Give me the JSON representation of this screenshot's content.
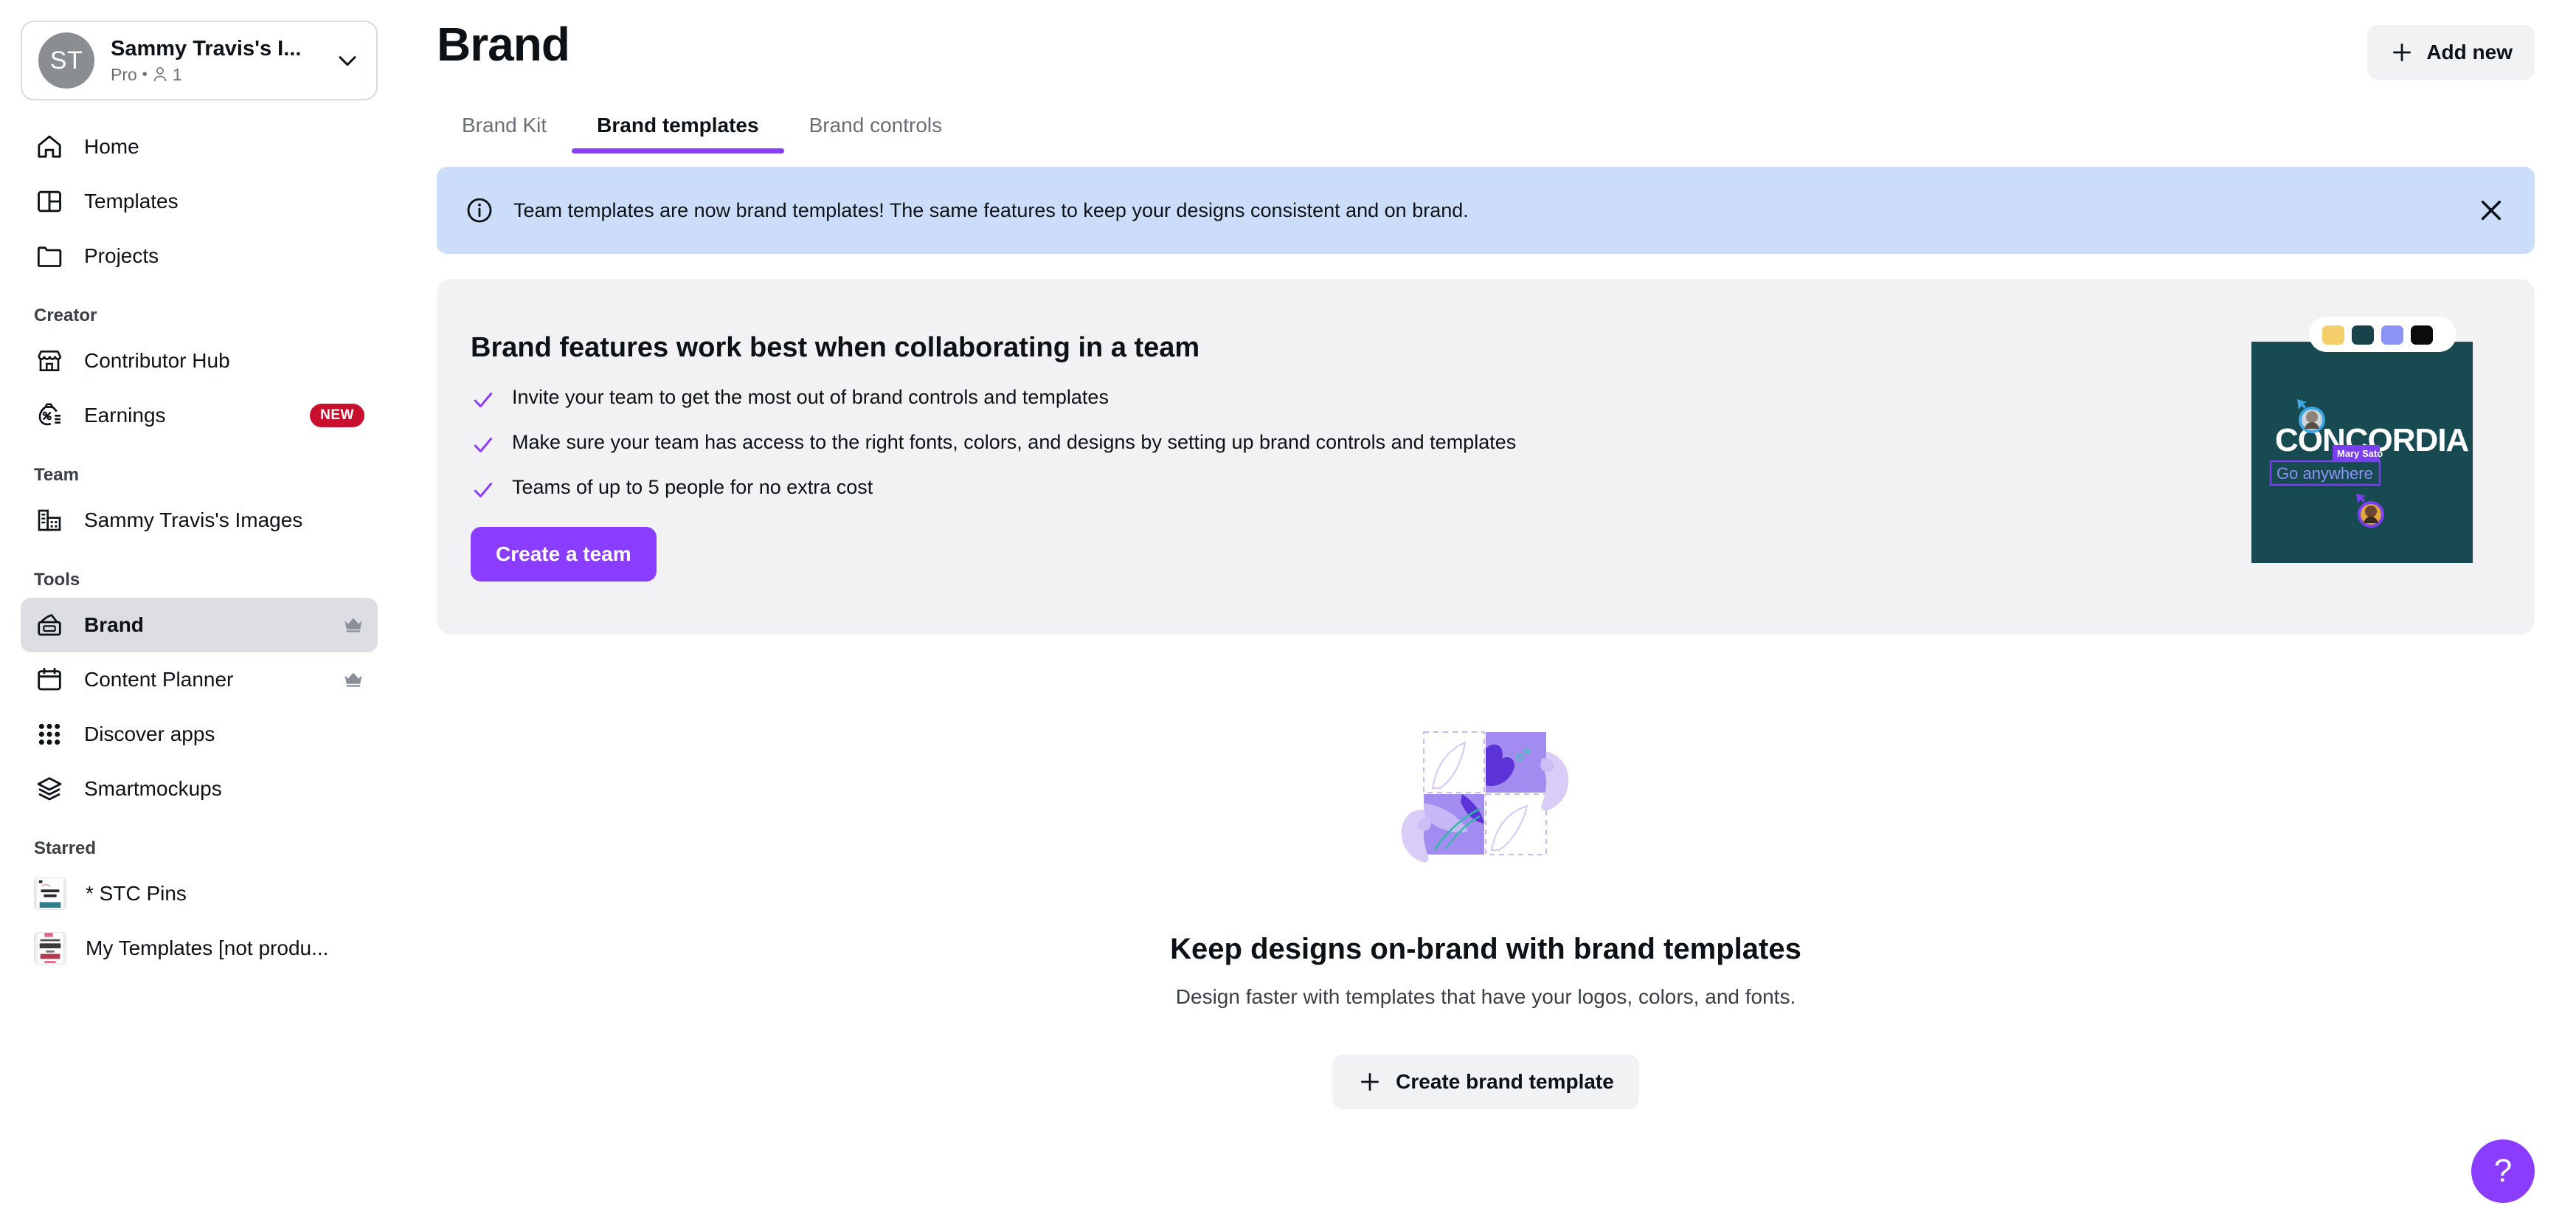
{
  "account": {
    "initials": "ST",
    "name": "Sammy Travis's I...",
    "plan": "Pro",
    "separator": "•",
    "member_count": "1"
  },
  "sidebar": {
    "nav_primary": [
      {
        "label": "Home",
        "icon": "home-icon"
      },
      {
        "label": "Templates",
        "icon": "templates-icon"
      },
      {
        "label": "Projects",
        "icon": "folder-icon"
      }
    ],
    "creator_heading": "Creator",
    "creator_items": [
      {
        "label": "Contributor Hub",
        "icon": "storefront-icon",
        "badge": ""
      },
      {
        "label": "Earnings",
        "icon": "money-bag-icon",
        "badge": "NEW"
      }
    ],
    "team_heading": "Team",
    "team_items": [
      {
        "label": "Sammy Travis's Images",
        "icon": "buildings-icon"
      }
    ],
    "tools_heading": "Tools",
    "tools_items": [
      {
        "label": "Brand",
        "icon": "brand-icon",
        "active": true,
        "crown": true
      },
      {
        "label": "Content Planner",
        "icon": "calendar-icon",
        "active": false,
        "crown": true
      },
      {
        "label": "Discover apps",
        "icon": "grid-apps-icon",
        "active": false,
        "crown": false
      },
      {
        "label": "Smartmockups",
        "icon": "layers-icon",
        "active": false,
        "crown": false
      }
    ],
    "starred_heading": "Starred",
    "starred_items": [
      {
        "label": "* STC Pins",
        "thumb_text": "FONTS ON"
      },
      {
        "label": "My Templates [not produ...",
        "thumb_text": "Fonts"
      }
    ]
  },
  "header": {
    "title": "Brand",
    "add_new_label": "Add new",
    "add_new_icon": "plus-icon"
  },
  "tabs": [
    {
      "label": "Brand Kit",
      "active": false
    },
    {
      "label": "Brand templates",
      "active": true
    },
    {
      "label": "Brand controls",
      "active": false
    }
  ],
  "banner": {
    "icon": "info-circle-icon",
    "text": "Team templates are now brand templates! The same features to keep your designs consistent and on brand.",
    "close_icon": "close-icon"
  },
  "promo": {
    "heading": "Brand features work best when collaborating in a team",
    "bullets": [
      "Invite your team to get the most out of brand controls and templates",
      "Make sure your team has access to the right fonts, colors, and designs by setting up brand controls and templates",
      "Teams of up to 5 people for no extra cost"
    ],
    "cta_label": "Create a team",
    "artwork": {
      "brand_word": "CONCORDIA",
      "tagline": "Go anywhere",
      "collaborator_name": "Mary Sato",
      "swatches": [
        "#f3ce6a",
        "#18434a",
        "#8b93f5",
        "#0b0b0b"
      ],
      "card_bg": "#184a52"
    }
  },
  "empty_state": {
    "heading": "Keep designs on-brand with brand templates",
    "subtext": "Design faster with templates that have your logos, colors, and fonts.",
    "cta_label": "Create brand template",
    "cta_icon": "plus-icon"
  },
  "help": {
    "label": "?",
    "icon": "question-mark-icon"
  },
  "colors": {
    "accent_purple": "#8b3dff",
    "banner_blue": "#cbddf8",
    "badge_red": "#c8102e",
    "promo_bg": "#f2f2f4",
    "active_row": "#dcdee3"
  }
}
